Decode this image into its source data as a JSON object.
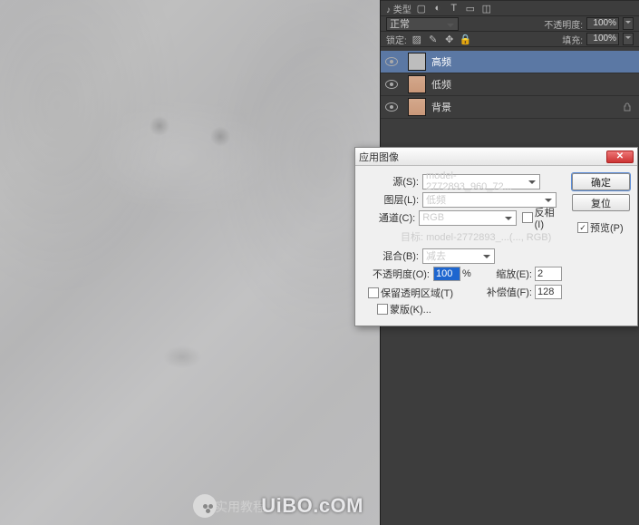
{
  "canvas": {
    "watermark_site": "UiBO.cOM",
    "watermark_label": "实用教程"
  },
  "options": {
    "type_label": "♪ 类型",
    "blend_label": "正常",
    "opacity_label": "不透明度:",
    "opacity_value": "100%",
    "lock_label": "锁定:",
    "fill_label": "填充:",
    "fill_value": "100%"
  },
  "layers": [
    {
      "name": "高频",
      "selected": true,
      "thumb": "gray",
      "locked": false
    },
    {
      "name": "低频",
      "selected": false,
      "thumb": "face",
      "locked": false
    },
    {
      "name": "背景",
      "selected": false,
      "thumb": "face",
      "locked": true
    }
  ],
  "dialog": {
    "title": "应用图像",
    "source_label": "源(S):",
    "source_value": "model-2772893_960_72...",
    "layer_label": "图层(L):",
    "layer_value": "低频",
    "channel_label": "通道(C):",
    "channel_value": "RGB",
    "invert_label": "反相(I)",
    "target_label": "目标:",
    "target_value": "model-2772893_...(..., RGB)",
    "blend_label": "混合(B):",
    "blend_value": "减去",
    "opacity_label": "不透明度(O):",
    "opacity_value": "100",
    "opacity_suffix": "%",
    "scale_label": "缩放(E):",
    "scale_value": "2",
    "offset_label": "补偿值(F):",
    "offset_value": "128",
    "preserve_label": "保留透明区域(T)",
    "mask_label": "蒙版(K)...",
    "ok": "确定",
    "cancel": "复位",
    "preview": "预览(P)",
    "preview_checked": true
  }
}
